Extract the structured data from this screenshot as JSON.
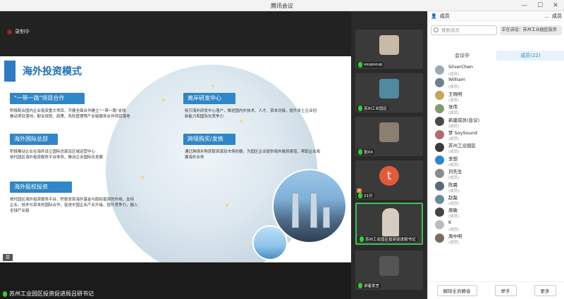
{
  "window": {
    "title": "腾讯会议"
  },
  "stage": {
    "recording_label": "录制中",
    "speaker_label": "苏州工业园区投资促进局吕研书记",
    "slide": {
      "title": "海外投资模式",
      "sections": [
        {
          "heading": "\"一带一路\"项目合作",
          "lines": [
            "积极配合国内企业投资重大项目，开展全面合作建立\"一带一路\"支线",
            "推动项目落地，配合规划、政策、风险管理等产业链服务合作项目落地"
          ]
        },
        {
          "heading": "海外国际总部",
          "lines": [
            "积极推动企业在海外设立国际总部及区域运营中心",
            "依托园区海外投资服务平台体系，推动企业国际化发展"
          ]
        },
        {
          "heading": "海外股权投资",
          "lines": [
            "依托园区海外投资服务平台，积极发挥海外基金与股权投资的作用，支持",
            "企业、技术与资本的国际合作，促进中国企业产业升级、提升竞争力，融入",
            "全球产业链"
          ]
        },
        {
          "heading": "离岸研发中心",
          "lines": [
            "吸引海外研发中心落户，推进国内外技术、人才、资本对接，提升本土企业创",
            "新能力和国际化竞争力"
          ]
        },
        {
          "heading": "跨境购买/发债",
          "lines": [
            "通过跨境并购获取资源及市场份额，为园区企业提供海外融资渠道，帮助企业拓",
            "展海外业务"
          ]
        }
      ]
    }
  },
  "videos": [
    {
      "name": "soupsoup"
    },
    {
      "name": "苏州工业园区"
    },
    {
      "name": "张XX"
    },
    {
      "name": "21分",
      "badge": "2"
    },
    {
      "name": "苏州工业园区投资促进局书记",
      "active": true
    },
    {
      "name": "讲者发言"
    }
  ],
  "panel": {
    "header": {
      "label": "成员",
      "more": "…",
      "member_count_label": "成员"
    },
    "search_placeholder": "搜索成员",
    "meeting_name": "正在讲话：苏州工业园区投资",
    "tabs": [
      {
        "label": "会议中",
        "active": false
      },
      {
        "label": "成员(22)",
        "active": true
      }
    ],
    "participants": [
      {
        "name": "SilverChen",
        "role": "(成员)"
      },
      {
        "name": "William",
        "role": "(成员)"
      },
      {
        "name": "王晓明",
        "role": "(成员)"
      },
      {
        "name": "张伟",
        "role": "(成员)"
      },
      {
        "name": "新建成员(会议)",
        "role": "(成员)"
      },
      {
        "name": "梦 SoySound",
        "role": "(成员)"
      },
      {
        "name": "苏州工业园区",
        "role": "(成员)"
      },
      {
        "name": "李想",
        "role": "(成员)"
      },
      {
        "name": "刘先生",
        "role": "(成员)"
      },
      {
        "name": "陈晨",
        "role": "(成员)"
      },
      {
        "name": "赵磊",
        "role": "(成员)"
      },
      {
        "name": "周敏",
        "role": "(成员)"
      },
      {
        "name": "K",
        "role": "(成员)"
      },
      {
        "name": "周中明",
        "role": "(成员)"
      }
    ],
    "footer": {
      "mute_all": "解除全员静音",
      "raise": "举手",
      "more": "更多"
    }
  },
  "colors": {
    "accent": "#2f86c8",
    "active_border": "#3bbf5a"
  }
}
